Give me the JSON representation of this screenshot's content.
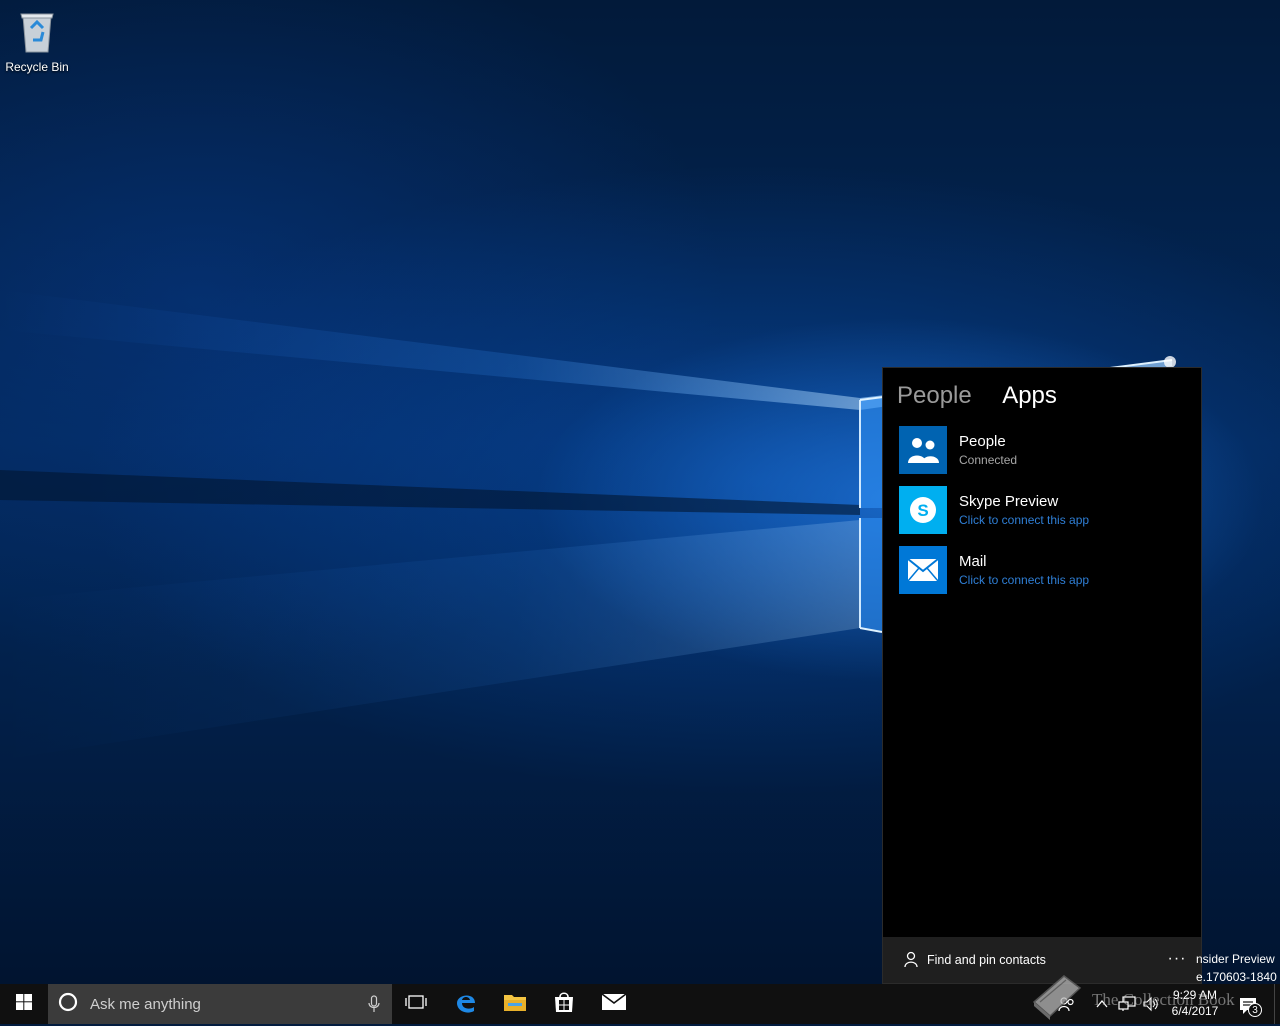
{
  "desktop": {
    "recycle_bin_label": "Recycle Bin",
    "watermark": {
      "line1": "nsider Preview",
      "line2": "e.170603-1840"
    }
  },
  "people_flyout": {
    "tabs": [
      {
        "label": "People",
        "active": false
      },
      {
        "label": "Apps",
        "active": true
      }
    ],
    "apps": [
      {
        "name": "People",
        "status": "Connected",
        "icon": "people-icon",
        "tile_color": "#0063b1"
      },
      {
        "name": "Skype Preview",
        "status": "Click to connect this app",
        "icon": "skype-icon",
        "tile_color": "#00aff0"
      },
      {
        "name": "Mail",
        "status": "Click to connect this app",
        "icon": "mail-icon",
        "tile_color": "#0078d7"
      }
    ],
    "footer": {
      "find_pin_label": "Find and pin contacts",
      "more_label": "···"
    }
  },
  "taskbar": {
    "search_placeholder": "Ask me anything",
    "pinned": [
      "task-view-icon",
      "edge-icon",
      "file-explorer-icon",
      "store-icon",
      "mail-icon"
    ],
    "clock": {
      "time": "9:29 AM",
      "date": "6/4/2017"
    },
    "notification_count": "3",
    "collection_watermark": "The Collection Book"
  },
  "colors": {
    "accent": "#0078d7",
    "link": "#2f7fd6",
    "taskbar": "#101010",
    "flyout_bg": "#000000"
  }
}
